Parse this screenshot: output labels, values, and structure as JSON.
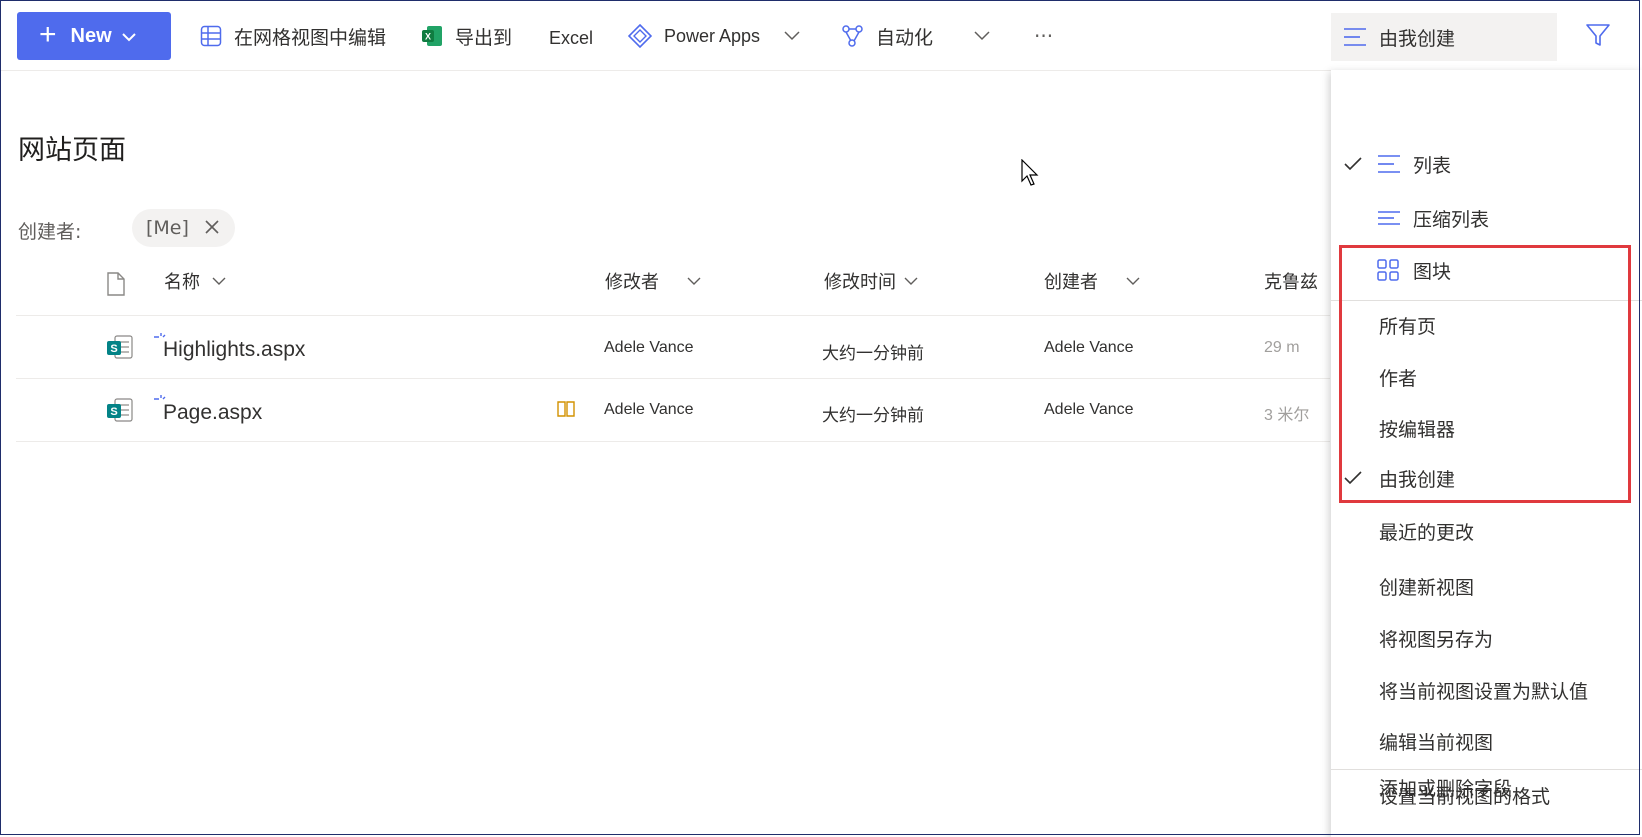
{
  "toolbar": {
    "new_label": "New",
    "edit_grid_label": "在网格视图中编辑",
    "export_label": "导出到",
    "excel_label": "Excel",
    "powerapps_label": "Power Apps",
    "automate_label": "自动化",
    "more_label": "···",
    "view_selector_label": "由我创建"
  },
  "page": {
    "title": "网站页面",
    "filter_label": "创建者:",
    "filter_chip": "[Me]"
  },
  "columns": {
    "name": "名称",
    "modified_by": "修改者",
    "modified": "修改时间",
    "created_by": "创建者",
    "partial": "克鲁兹"
  },
  "rows": [
    {
      "name": "Highlights.aspx",
      "modified_by": "Adele Vance",
      "modified": "大约一分钟前",
      "created_by": "Adele Vance",
      "partial": "29 m"
    },
    {
      "name": "Page.aspx",
      "modified_by": "Adele Vance",
      "modified": "大约一分钟前",
      "created_by": "Adele Vance",
      "partial": "3 米尔"
    }
  ],
  "view_menu": {
    "layouts": [
      "列表",
      "压缩列表",
      "图块"
    ],
    "views": [
      "所有页",
      "作者",
      "按编辑器",
      "由我创建",
      "最近的更改"
    ],
    "actions": [
      "创建新视图",
      "将视图另存为",
      "将当前视图设置为默认值",
      "编辑当前视图"
    ],
    "format": [
      "设置当前视图的格式",
      "添加或删除字段"
    ]
  },
  "colors": {
    "accent": "#4f6bed",
    "highlight_border": "#e0393e",
    "excel_green": "#107c41",
    "sharepoint_teal": "#038387"
  }
}
